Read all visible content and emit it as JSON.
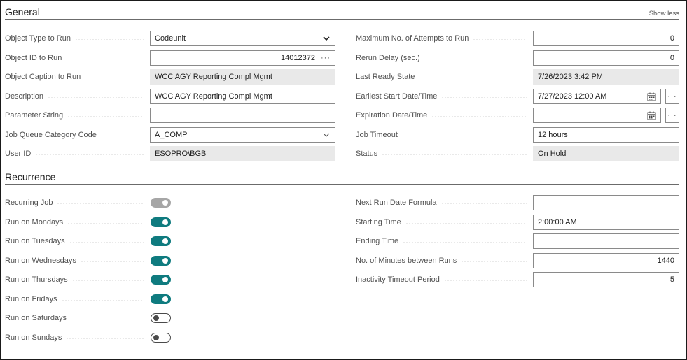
{
  "general": {
    "title": "General",
    "show_less": "Show less",
    "left": [
      {
        "label": "Object Type to Run",
        "value": "Codeunit"
      },
      {
        "label": "Object ID to Run",
        "value": "14012372"
      },
      {
        "label": "Object Caption to Run",
        "value": "WCC AGY Reporting Compl Mgmt"
      },
      {
        "label": "Description",
        "value": "WCC AGY Reporting Compl Mgmt"
      },
      {
        "label": "Parameter String",
        "value": ""
      },
      {
        "label": "Job Queue Category Code",
        "value": "A_COMP"
      },
      {
        "label": "User ID",
        "value": "ESOPRO\\BGB"
      }
    ],
    "right": [
      {
        "label": "Maximum No. of Attempts to Run",
        "value": "0"
      },
      {
        "label": "Rerun Delay (sec.)",
        "value": "0"
      },
      {
        "label": "Last Ready State",
        "value": "7/26/2023 3:42 PM"
      },
      {
        "label": "Earliest Start Date/Time",
        "value": "7/27/2023 12:00 AM"
      },
      {
        "label": "Expiration Date/Time",
        "value": ""
      },
      {
        "label": "Job Timeout",
        "value": "12 hours"
      },
      {
        "label": "Status",
        "value": "On Hold"
      }
    ]
  },
  "recurrence": {
    "title": "Recurrence",
    "toggles": [
      {
        "label": "Recurring Job",
        "state": "on",
        "enabled": false
      },
      {
        "label": "Run on Mondays",
        "state": "on",
        "enabled": true
      },
      {
        "label": "Run on Tuesdays",
        "state": "on",
        "enabled": true
      },
      {
        "label": "Run on Wednesdays",
        "state": "on",
        "enabled": true
      },
      {
        "label": "Run on Thursdays",
        "state": "on",
        "enabled": true
      },
      {
        "label": "Run on Fridays",
        "state": "on",
        "enabled": true
      },
      {
        "label": "Run on Saturdays",
        "state": "off",
        "enabled": true
      },
      {
        "label": "Run on Sundays",
        "state": "off",
        "enabled": true
      }
    ],
    "right": [
      {
        "label": "Next Run Date Formula",
        "value": ""
      },
      {
        "label": "Starting Time",
        "value": "2:00:00 AM"
      },
      {
        "label": "Ending Time",
        "value": ""
      },
      {
        "label": "No. of Minutes between Runs",
        "value": "1440"
      },
      {
        "label": "Inactivity Timeout Period",
        "value": "5"
      }
    ]
  },
  "icons": {
    "more": "ellipsis-icon",
    "dropdown": "chevron-down-icon",
    "calendar": "calendar-icon"
  },
  "colors": {
    "toggle_on": "#0f7b7f",
    "toggle_disabled": "#a6a6a6",
    "readonly_bg": "#e9e9e9"
  },
  "ellipsis_text": "···"
}
